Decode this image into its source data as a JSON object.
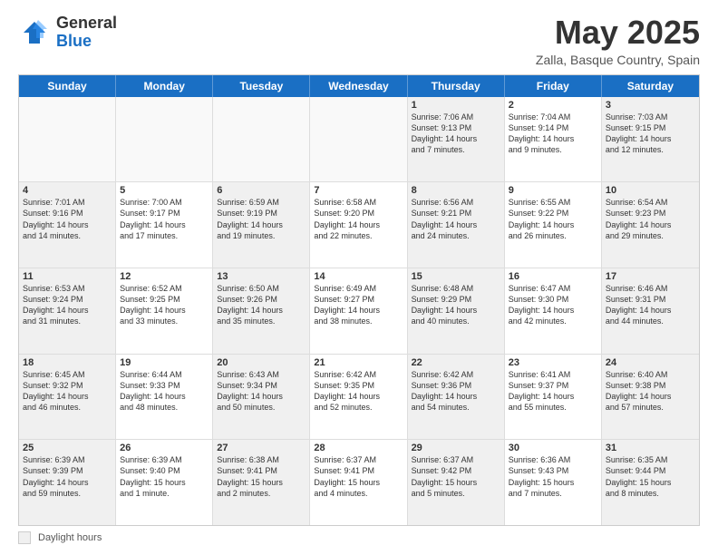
{
  "logo": {
    "general": "General",
    "blue": "Blue"
  },
  "title": "May 2025",
  "subtitle": "Zalla, Basque Country, Spain",
  "days_of_week": [
    "Sunday",
    "Monday",
    "Tuesday",
    "Wednesday",
    "Thursday",
    "Friday",
    "Saturday"
  ],
  "legend_label": "Daylight hours",
  "weeks": [
    [
      {
        "day": "",
        "text": "",
        "empty": true
      },
      {
        "day": "",
        "text": "",
        "empty": true
      },
      {
        "day": "",
        "text": "",
        "empty": true
      },
      {
        "day": "",
        "text": "",
        "empty": true
      },
      {
        "day": "1",
        "text": "Sunrise: 7:06 AM\nSunset: 9:13 PM\nDaylight: 14 hours\nand 7 minutes."
      },
      {
        "day": "2",
        "text": "Sunrise: 7:04 AM\nSunset: 9:14 PM\nDaylight: 14 hours\nand 9 minutes."
      },
      {
        "day": "3",
        "text": "Sunrise: 7:03 AM\nSunset: 9:15 PM\nDaylight: 14 hours\nand 12 minutes."
      }
    ],
    [
      {
        "day": "4",
        "text": "Sunrise: 7:01 AM\nSunset: 9:16 PM\nDaylight: 14 hours\nand 14 minutes."
      },
      {
        "day": "5",
        "text": "Sunrise: 7:00 AM\nSunset: 9:17 PM\nDaylight: 14 hours\nand 17 minutes."
      },
      {
        "day": "6",
        "text": "Sunrise: 6:59 AM\nSunset: 9:19 PM\nDaylight: 14 hours\nand 19 minutes."
      },
      {
        "day": "7",
        "text": "Sunrise: 6:58 AM\nSunset: 9:20 PM\nDaylight: 14 hours\nand 22 minutes."
      },
      {
        "day": "8",
        "text": "Sunrise: 6:56 AM\nSunset: 9:21 PM\nDaylight: 14 hours\nand 24 minutes."
      },
      {
        "day": "9",
        "text": "Sunrise: 6:55 AM\nSunset: 9:22 PM\nDaylight: 14 hours\nand 26 minutes."
      },
      {
        "day": "10",
        "text": "Sunrise: 6:54 AM\nSunset: 9:23 PM\nDaylight: 14 hours\nand 29 minutes."
      }
    ],
    [
      {
        "day": "11",
        "text": "Sunrise: 6:53 AM\nSunset: 9:24 PM\nDaylight: 14 hours\nand 31 minutes."
      },
      {
        "day": "12",
        "text": "Sunrise: 6:52 AM\nSunset: 9:25 PM\nDaylight: 14 hours\nand 33 minutes."
      },
      {
        "day": "13",
        "text": "Sunrise: 6:50 AM\nSunset: 9:26 PM\nDaylight: 14 hours\nand 35 minutes."
      },
      {
        "day": "14",
        "text": "Sunrise: 6:49 AM\nSunset: 9:27 PM\nDaylight: 14 hours\nand 38 minutes."
      },
      {
        "day": "15",
        "text": "Sunrise: 6:48 AM\nSunset: 9:29 PM\nDaylight: 14 hours\nand 40 minutes."
      },
      {
        "day": "16",
        "text": "Sunrise: 6:47 AM\nSunset: 9:30 PM\nDaylight: 14 hours\nand 42 minutes."
      },
      {
        "day": "17",
        "text": "Sunrise: 6:46 AM\nSunset: 9:31 PM\nDaylight: 14 hours\nand 44 minutes."
      }
    ],
    [
      {
        "day": "18",
        "text": "Sunrise: 6:45 AM\nSunset: 9:32 PM\nDaylight: 14 hours\nand 46 minutes."
      },
      {
        "day": "19",
        "text": "Sunrise: 6:44 AM\nSunset: 9:33 PM\nDaylight: 14 hours\nand 48 minutes."
      },
      {
        "day": "20",
        "text": "Sunrise: 6:43 AM\nSunset: 9:34 PM\nDaylight: 14 hours\nand 50 minutes."
      },
      {
        "day": "21",
        "text": "Sunrise: 6:42 AM\nSunset: 9:35 PM\nDaylight: 14 hours\nand 52 minutes."
      },
      {
        "day": "22",
        "text": "Sunrise: 6:42 AM\nSunset: 9:36 PM\nDaylight: 14 hours\nand 54 minutes."
      },
      {
        "day": "23",
        "text": "Sunrise: 6:41 AM\nSunset: 9:37 PM\nDaylight: 14 hours\nand 55 minutes."
      },
      {
        "day": "24",
        "text": "Sunrise: 6:40 AM\nSunset: 9:38 PM\nDaylight: 14 hours\nand 57 minutes."
      }
    ],
    [
      {
        "day": "25",
        "text": "Sunrise: 6:39 AM\nSunset: 9:39 PM\nDaylight: 14 hours\nand 59 minutes."
      },
      {
        "day": "26",
        "text": "Sunrise: 6:39 AM\nSunset: 9:40 PM\nDaylight: 15 hours\nand 1 minute."
      },
      {
        "day": "27",
        "text": "Sunrise: 6:38 AM\nSunset: 9:41 PM\nDaylight: 15 hours\nand 2 minutes."
      },
      {
        "day": "28",
        "text": "Sunrise: 6:37 AM\nSunset: 9:41 PM\nDaylight: 15 hours\nand 4 minutes."
      },
      {
        "day": "29",
        "text": "Sunrise: 6:37 AM\nSunset: 9:42 PM\nDaylight: 15 hours\nand 5 minutes."
      },
      {
        "day": "30",
        "text": "Sunrise: 6:36 AM\nSunset: 9:43 PM\nDaylight: 15 hours\nand 7 minutes."
      },
      {
        "day": "31",
        "text": "Sunrise: 6:35 AM\nSunset: 9:44 PM\nDaylight: 15 hours\nand 8 minutes."
      }
    ]
  ]
}
